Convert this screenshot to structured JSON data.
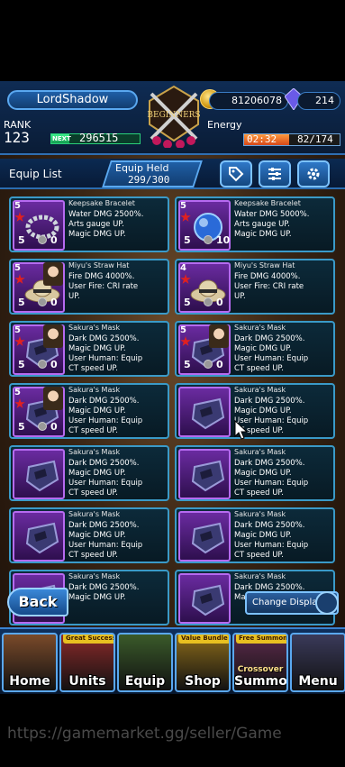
{
  "header": {
    "player_name": "LordShadow",
    "crest_text": "BEGINNERS",
    "gil": "81206078",
    "lapis": "214",
    "rank_label": "RANK",
    "rank_value": "123",
    "next_label": "NEXT",
    "next_exp": "296515",
    "next_progress_percent": 20,
    "energy_label": "Energy",
    "energy_timer": "02:32",
    "energy_value": "82/174",
    "energy_progress_fraction": 0.47
  },
  "toolbar": {
    "title": "Equip List",
    "held_label": "Equip Held",
    "held_value": "299/300",
    "icons": [
      "tag-icon",
      "sort-icon",
      "gear-icon"
    ]
  },
  "cards": [
    {
      "title": "Keepsake Bracelet",
      "rarity": "5",
      "level": "5",
      "lb": "0",
      "lines": [
        "Water DMG 2500%.",
        "Arts gauge UP.",
        "Magic DMG UP."
      ],
      "art": "bracelet",
      "chara": false
    },
    {
      "title": "Keepsake Bracelet",
      "rarity": "5",
      "level": "5",
      "lb": "10",
      "lines": [
        "Water DMG 5000%.",
        "Arts gauge UP.",
        "Magic DMG UP."
      ],
      "art": "orb",
      "chara": false
    },
    {
      "title": "Miyu's Straw Hat",
      "rarity": "5",
      "level": "5",
      "lb": "0",
      "lines": [
        "Fire DMG 4000%.",
        "User Fire: CRI rate",
        "UP."
      ],
      "art": "hat",
      "chara": true
    },
    {
      "title": "Miyu's Straw Hat",
      "rarity": "4",
      "level": "5",
      "lb": "0",
      "lines": [
        "Fire DMG 4000%.",
        "User Fire: CRI rate",
        "UP."
      ],
      "art": "hat",
      "chara": false
    },
    {
      "title": "Sakura's Mask",
      "rarity": "5",
      "level": "5",
      "lb": "0",
      "lines": [
        "Dark DMG 2500%.",
        "Magic DMG UP.",
        "User Human: Equip",
        "CT speed UP."
      ],
      "art": "mask",
      "chara": true
    },
    {
      "title": "Sakura's Mask",
      "rarity": "5",
      "level": "5",
      "lb": "0",
      "lines": [
        "Dark DMG 2500%.",
        "Magic DMG UP.",
        "User Human: Equip",
        "CT speed UP."
      ],
      "art": "mask",
      "chara": true
    },
    {
      "title": "Sakura's Mask",
      "rarity": "5",
      "level": "5",
      "lb": "0",
      "lines": [
        "Dark DMG 2500%.",
        "Magic DMG UP.",
        "User Human: Equip",
        "CT speed UP."
      ],
      "art": "mask",
      "chara": true
    },
    {
      "title": "Sakura's Mask",
      "rarity": "",
      "level": "",
      "lb": "",
      "lines": [
        "Dark DMG 2500%.",
        "Magic DMG UP.",
        "User Human: Equip",
        "CT speed UP."
      ],
      "art": "mask",
      "chara": false
    },
    {
      "title": "Sakura's Mask",
      "rarity": "",
      "level": "",
      "lb": "",
      "lines": [
        "Dark DMG 2500%.",
        "Magic DMG UP.",
        "User Human: Equip",
        "CT speed UP."
      ],
      "art": "mask",
      "chara": false
    },
    {
      "title": "Sakura's Mask",
      "rarity": "",
      "level": "",
      "lb": "",
      "lines": [
        "Dark DMG 2500%.",
        "Magic DMG UP.",
        "User Human: Equip",
        "CT speed UP."
      ],
      "art": "mask",
      "chara": false
    },
    {
      "title": "Sakura's Mask",
      "rarity": "",
      "level": "",
      "lb": "",
      "lines": [
        "Dark DMG 2500%.",
        "Magic DMG UP.",
        "User Human: Equip",
        "CT speed UP."
      ],
      "art": "mask",
      "chara": false
    },
    {
      "title": "Sakura's Mask",
      "rarity": "",
      "level": "",
      "lb": "",
      "lines": [
        "Dark DMG 2500%.",
        "Magic DMG UP.",
        "User Human: Equip",
        "CT speed UP."
      ],
      "art": "mask",
      "chara": false
    },
    {
      "title": "Sakura's Mask",
      "rarity": "",
      "level": "",
      "lb": "",
      "lines": [
        "Dark DMG 2500%.",
        "Magic DMG UP.",
        "",
        ""
      ],
      "art": "mask",
      "chara": false
    },
    {
      "title": "Sakura's Mask",
      "rarity": "",
      "level": "",
      "lb": "",
      "lines": [
        "Dark DMG 2500%.",
        "Magic DMG UP.",
        "",
        ""
      ],
      "art": "mask",
      "chara": false
    }
  ],
  "controls": {
    "back_label": "Back",
    "change_display_label": "Change Display"
  },
  "nav": [
    {
      "label": "Home",
      "badge": "",
      "color": "#7a4a2a"
    },
    {
      "label": "Units",
      "badge": "Great Success Rate UP",
      "color": "#8a2a2a"
    },
    {
      "label": "Equip",
      "badge": "",
      "color": "#3a5a2a"
    },
    {
      "label": "Shop",
      "badge": "Value Bundle",
      "color": "#8a6a1a"
    },
    {
      "label": "Summon",
      "badge": "Free Summon",
      "color": "#5a2a4a",
      "sub": "Crossover"
    },
    {
      "label": "Menu",
      "badge": "",
      "color": "#3a3a5a"
    }
  ],
  "watermark": "https://gamemarket.gg/seller/Game"
}
